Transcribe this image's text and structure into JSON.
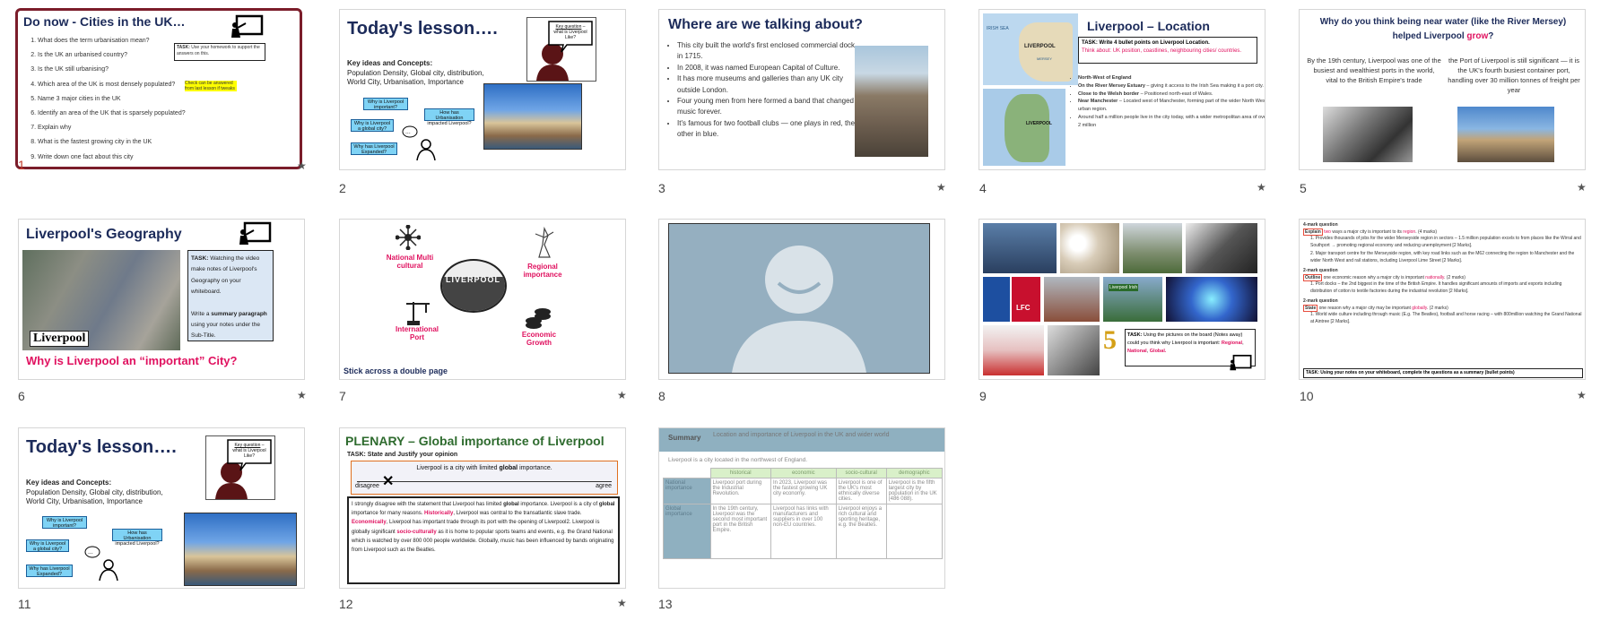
{
  "slides": [
    {
      "num": "1",
      "title": "Do now - Cities in the UK…",
      "questions": [
        "What does the term urbanisation mean?",
        "Is the UK an urbanised country?",
        "Is the UK still urbanising?",
        "Which area of the UK is most densely populated?",
        "Name 3 major cities in the UK",
        "Identify an area of the UK that is sparsely populated?",
        "Explain why",
        "What is the fastest growing city in the UK",
        "Write down one fact about this city"
      ],
      "task_label": "TASK:",
      "task_text": "Use your homework to support the answers on this.",
      "highlight": "Check can be answered from last lesson if tweaks"
    },
    {
      "num": "2",
      "title": "Today's lesson….",
      "key_heading": "Key ideas and Concepts:",
      "key_text": "Population Density, Global city, distribution, World City, Urbanisation, Importance",
      "bubble_q": "Key question",
      "bubble_rest": "– what is Liverpool Like?",
      "boxes": [
        "Why is Liverpool important?",
        "How has Urbanisation impacted Liverpool?",
        "Why is Liverpool a global city?",
        "Why has Liverpool Expanded?"
      ]
    },
    {
      "num": "3",
      "title": "Where are we talking about?",
      "bullets": [
        "This city built the world's first enclosed commercial dock in 1715.",
        "In 2008, it was named European Capital of Culture.",
        "It has more museums and galleries than any UK city outside London.",
        "Four young men from here formed a band that changed music forever.",
        "It's famous for two football clubs — one plays in red, the other in blue."
      ]
    },
    {
      "num": "4",
      "title": "Liverpool – Location",
      "map_labels": [
        "IRISH SEA",
        "LIVERPOOL",
        "MERSEY",
        "LIVERPOOL"
      ],
      "task": "TASK: Write 4 bullet points on Liverpool Location.",
      "think": "Think about: UK position, coastlines, neighbouring cities/ countries.",
      "points": [
        {
          "bold": "North-West of England",
          "rest": ""
        },
        {
          "bold": "On the River Mersey Estuary",
          "rest": " – giving it access to the Irish Sea making it a port city."
        },
        {
          "bold": "Close to the Welsh border",
          "rest": " – Positioned north-east of Wales."
        },
        {
          "bold": "Near Manchester",
          "rest": " – Located west of Manchester, forming part of the wider North West urban region."
        },
        {
          "bold": "",
          "rest": "Around half a million people live in the city today, with a wider metropolitan area of over 2 million"
        }
      ]
    },
    {
      "num": "5",
      "title_a": "Why do you think being near water (like the River Mersey) helped Liverpool ",
      "title_b": "grow",
      "title_c": "?",
      "left": "By the 19th century, Liverpool was one of the busiest and wealthiest ports in the world, vital to the British Empire's trade",
      "right": "the Port of Liverpool is still significant — it is the UK's fourth busiest container port, handling over 30 million tonnes of freight per year"
    },
    {
      "num": "6",
      "title": "Liverpool's Geography",
      "map_label": "Liverpool",
      "task_label": "TASK:",
      "task_a": "Watching the video make notes of Liverpool's Geography on your whiteboard.",
      "task_b": "Write a ",
      "task_bold": "summary paragraph",
      "task_c": " using your notes under the Sub-Title.",
      "question": "Why is Liverpool an “important” City?"
    },
    {
      "num": "7",
      "labels": [
        "National Multi cultural",
        "Regional importance",
        "International Port",
        "Economic Growth"
      ],
      "footer": "Stick across a double page",
      "logo": "LIVERPOOL"
    },
    {
      "num": "8"
    },
    {
      "num": "9",
      "task_a": "TASK:",
      "task_b": " Using the pictures on the board (Notes away) could you think why Liverpool is important: ",
      "r": "Regional",
      "n": "National",
      "g": "Global.",
      "five": "5",
      "tag1": "LFC",
      "tag2": "Liverpool Irish"
    },
    {
      "num": "10",
      "q1_head": "4-mark question",
      "q1_cmd": "Explain",
      "q1_two": " two",
      "q1_rest": " ways a major city is important to its ",
      "q1_scope": "region",
      "q1_marks": ". (4 marks)",
      "q1_a": "Provides thousands of jobs for the wider Merseyside region in sectors – 1.5 million population excels to from places like the Wirral and Southport → promoting regional economy and reducing unemployment [2 Marks].",
      "q1_b": "Major transport centre for the Merseyside region, with key road links such as the M62 connecting the region to Manchester and the wider North West and rail stations, including Liverpool Lime Street [2 Marks].",
      "q2_head": "2-mark question",
      "q2_cmd": "Outline",
      "q2_rest": " one economic reason why a major city is important ",
      "q2_scope": "nationally",
      "q2_marks": ". (2 marks)",
      "q2_a": "Port docks – the 2nd biggest in the time of the British Empire. It handles significant amounts of imports and exports including distribution of cotton to textile factories during the industrial revolution [2 Marks].",
      "q3_head": "2-mark question",
      "q3_cmd": "State",
      "q3_rest": " one reason why a major city may be important ",
      "q3_scope": "globally",
      "q3_marks": ". (2 marks)",
      "q3_a": "World wide culture including through music (E.g. The Beatles), football and horse racing – with 800million watching the Grand National at Aintree [2 Marks].",
      "task": "TASK: Using your notes on your whiteboard, complete the questions as a summary (bullet points)"
    },
    {
      "num": "11",
      "title": "Today's lesson….",
      "key_heading": "Key ideas and Concepts:",
      "key_text": "Population Density, Global city, distribution, World City, Urbanisation, Importance",
      "bubble_q": "Key question",
      "bubble_rest": "– what is Liverpool Like?",
      "boxes": [
        "Why is Liverpool important?",
        "How has Urbanisation impacted Liverpool?",
        "Why is Liverpool a global city?",
        "Why has Liverpool Expanded?"
      ]
    },
    {
      "num": "12",
      "title": "PLENARY – Global importance of Liverpool",
      "task": "TASK: State and Justify your opinion",
      "scale_a": "Liverpool is a city with limited ",
      "scale_b": "global",
      "scale_c": " importance.",
      "disagree": "disagree",
      "agree": "agree",
      "p1": "I strongly disagree with the statement that Liverpool has limited ",
      "p1b": "global",
      "p1c": " importance. Liverpool is a city of ",
      "p1d": "global",
      "p1e": " importance for many reasons. ",
      "hist": "Historically",
      "p2": ", Liverpool was central to the transatlantic slave trade. ",
      "econ": "Economically",
      "p3": ", Liverpool has important trade through its port with the opening of Liverpool2. Liverpool is globally significant ",
      "soc": "socio-culturally",
      "p4": " as it is home to popular sports teams and events, e.g. the Grand National which is watched by over 800 000 people worldwide. Globally, music has been influenced by bands originating from Liverpool such as the Beatles."
    },
    {
      "num": "13",
      "head": "Summary",
      "head_sub": "Location and importance of Liverpool in the UK and wider world",
      "intro": "Liverpool is a city located in the northwest of England.",
      "cols": [
        "historical",
        "economic",
        "socio-cultural",
        "demographic"
      ],
      "rows": [
        {
          "label": "National importance",
          "cells": [
            "Liverpool port during the Industrial Revolution.",
            "In 2023, Liverpool was the fastest growing UK city economy.",
            "Liverpool is one of the UK's most ethnically diverse cities.",
            "Liverpool is the fifth largest city by population in the UK (486 088)."
          ]
        },
        {
          "label": "Global importance",
          "cells": [
            "In the 19th century, Liverpool was the second most important port in the British Empire.",
            "Liverpool has links with manufacturers and suppliers in over 100 non-EU countries.",
            "Liverpool enjoys a rich cultural and sporting heritage, e.g. the Beatles.",
            ""
          ]
        }
      ]
    }
  ],
  "colors": {
    "accent": "#7b1d2a",
    "navy": "#1c2b5a",
    "pink": "#e0115f",
    "cyan": "#7fd3f5",
    "summary_head": "#8fb0c0",
    "summary_green": "#d9f0c9"
  }
}
